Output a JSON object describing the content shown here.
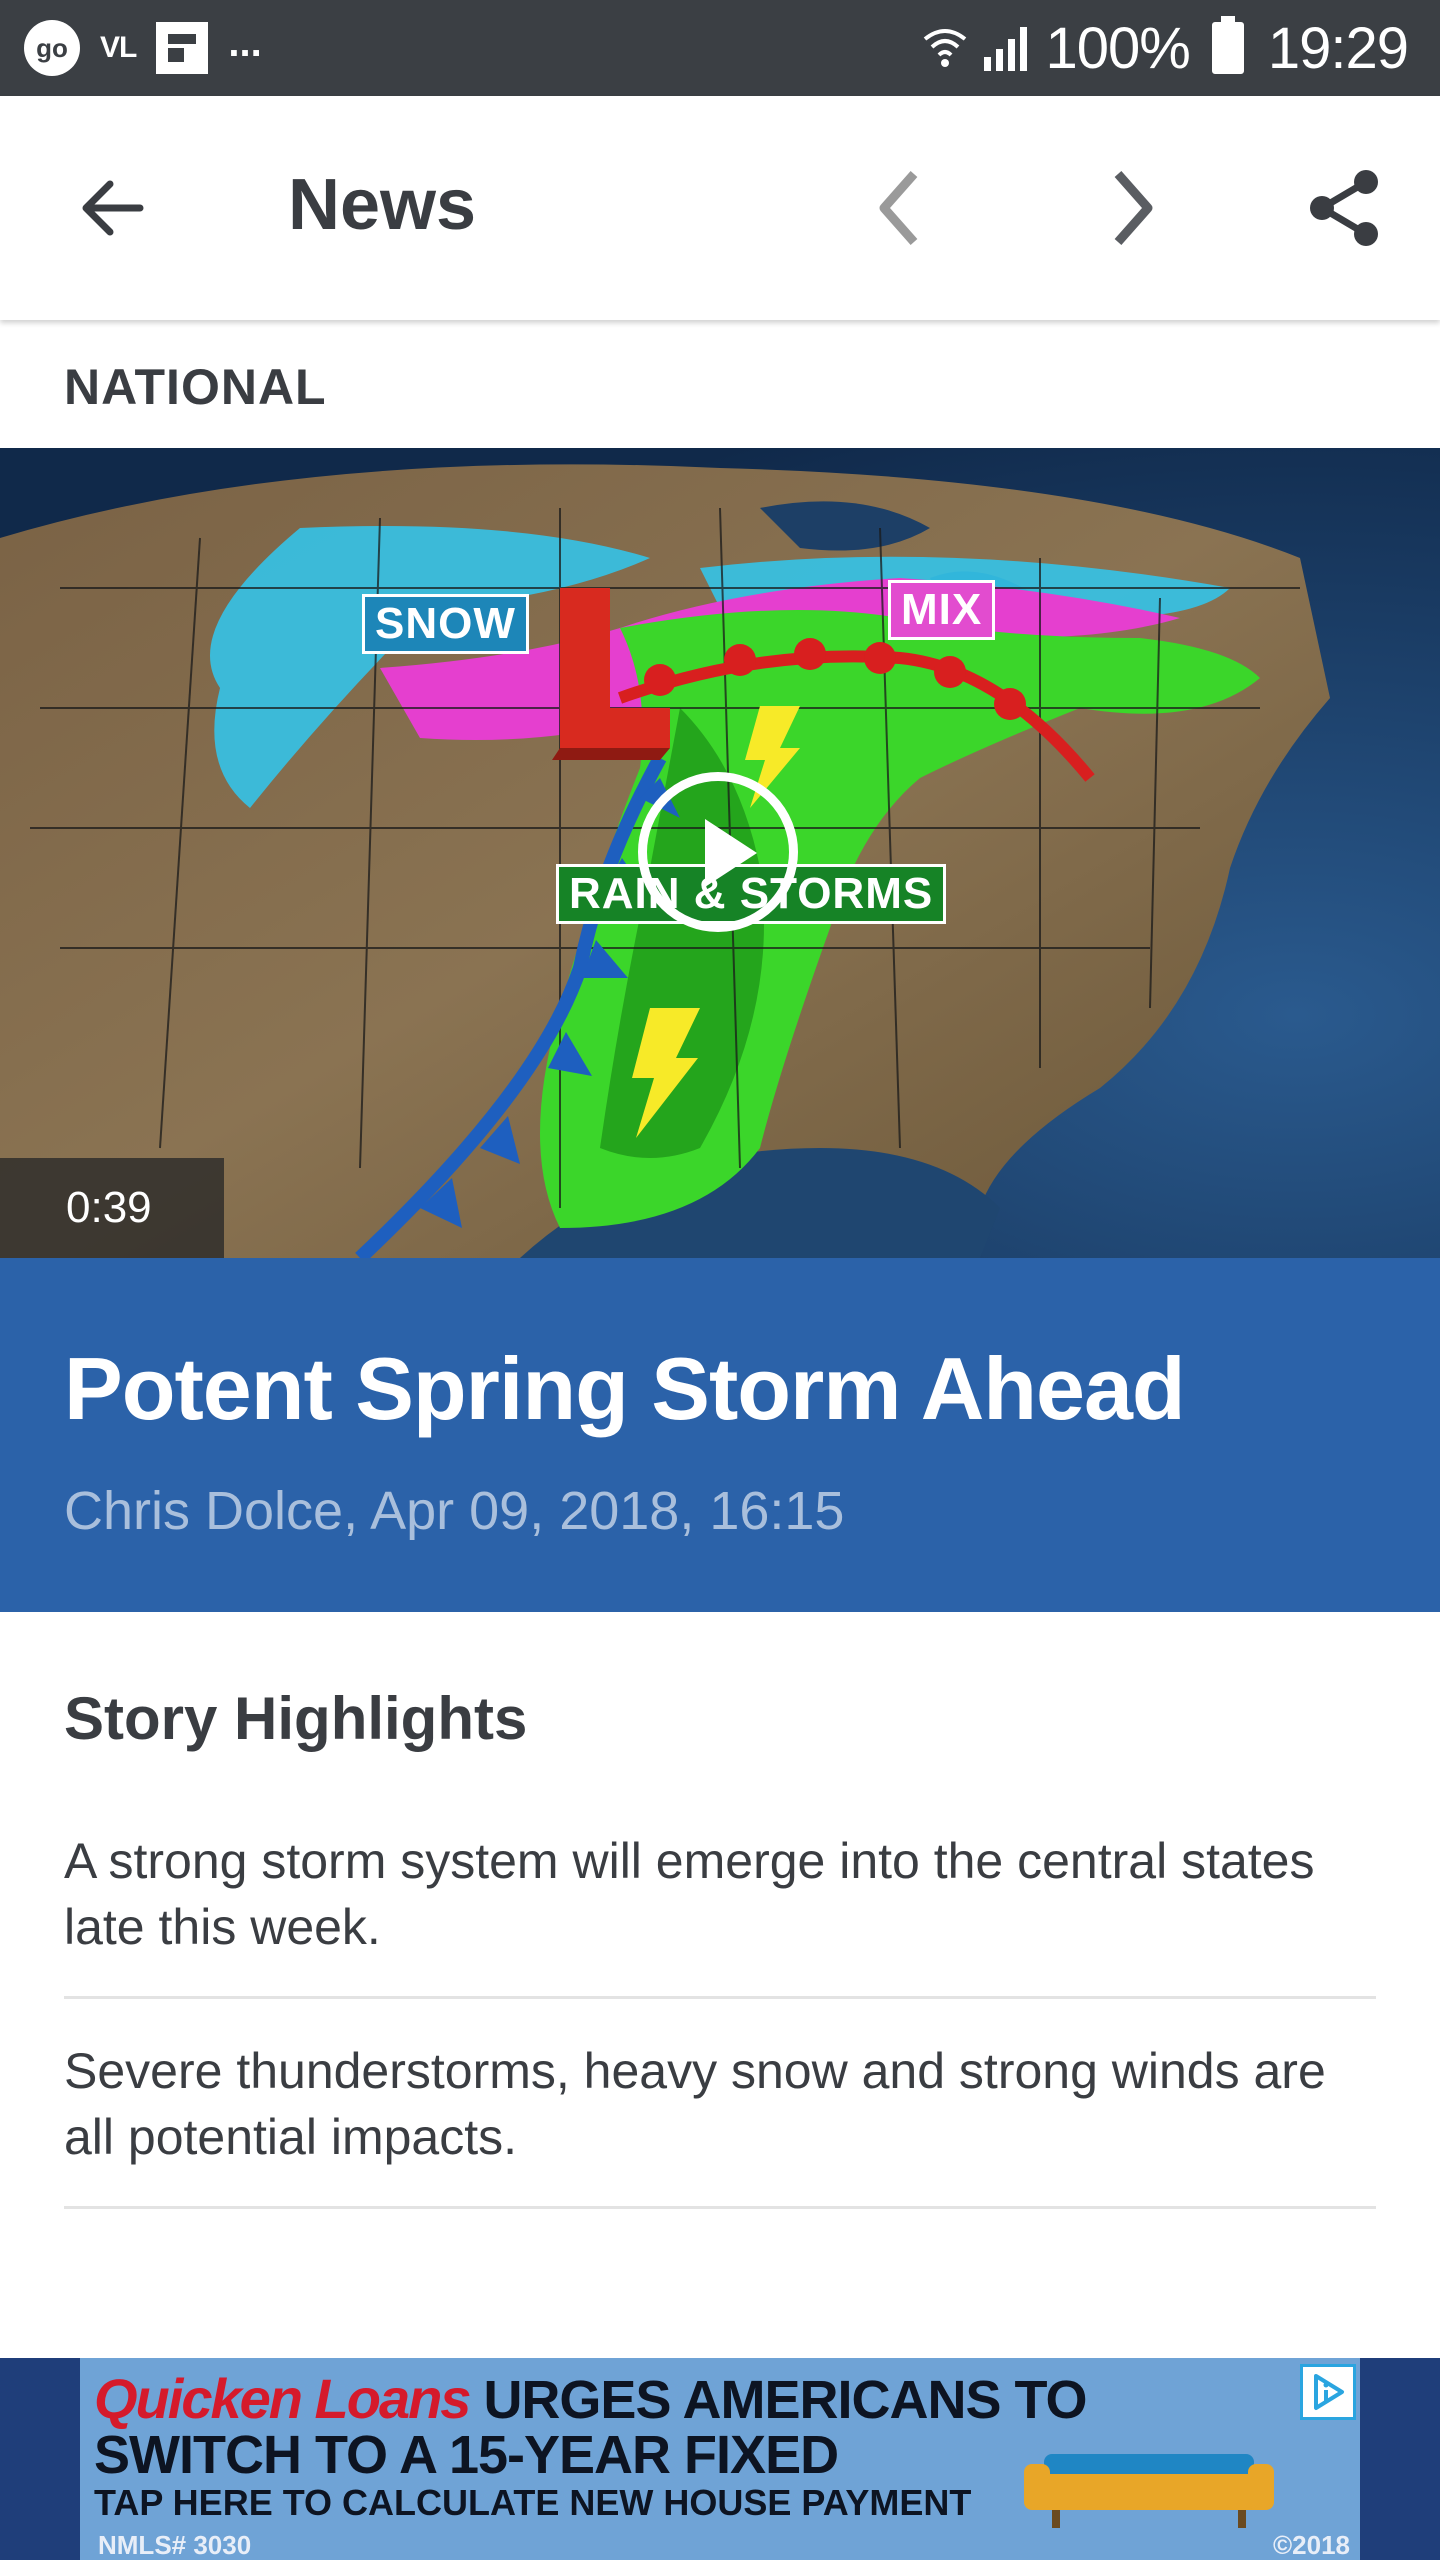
{
  "status_bar": {
    "left_icons": [
      "go",
      "VL",
      "flipboard-icon",
      "more-notifications-icon"
    ],
    "go_label": "go",
    "vl_label": "VL",
    "more_label": "...",
    "battery": "100%",
    "time": "19:29"
  },
  "toolbar": {
    "title": "News",
    "back_icon": "arrow-left-icon",
    "prev_icon": "chevron-left-icon",
    "next_icon": "chevron-right-icon",
    "share_icon": "share-icon"
  },
  "article": {
    "section": "NATIONAL",
    "video": {
      "duration": "0:39",
      "map_labels": {
        "snow": "SNOW",
        "mix": "MIX",
        "rain": "RAIN & STORMS"
      }
    },
    "headline": "Potent Spring Storm Ahead",
    "byline": "Chris Dolce, Apr 09, 2018, 16:15",
    "highlights_title": "Story Highlights",
    "highlights": [
      "A strong storm system will emerge into the central states late this week.",
      "Severe thunderstorms, heavy snow and strong winds are all potential impacts."
    ]
  },
  "ad": {
    "brand": "Quicken Loans",
    "headline_1": "URGES AMERICANS TO",
    "headline_2": "SWITCH TO A 15-YEAR FIXED",
    "subline": "TAP HERE TO CALCULATE NEW HOUSE PAYMENT",
    "nmls": "NMLS# 3030",
    "copyright": "©2018"
  },
  "colors": {
    "status_bar": "#3b3f44",
    "headline_band": "#2b62a9",
    "byline": "#a9bfdc",
    "text": "#3a3d42",
    "ad_background": "#6fa3d6",
    "ad_brand": "#d51a2b"
  }
}
